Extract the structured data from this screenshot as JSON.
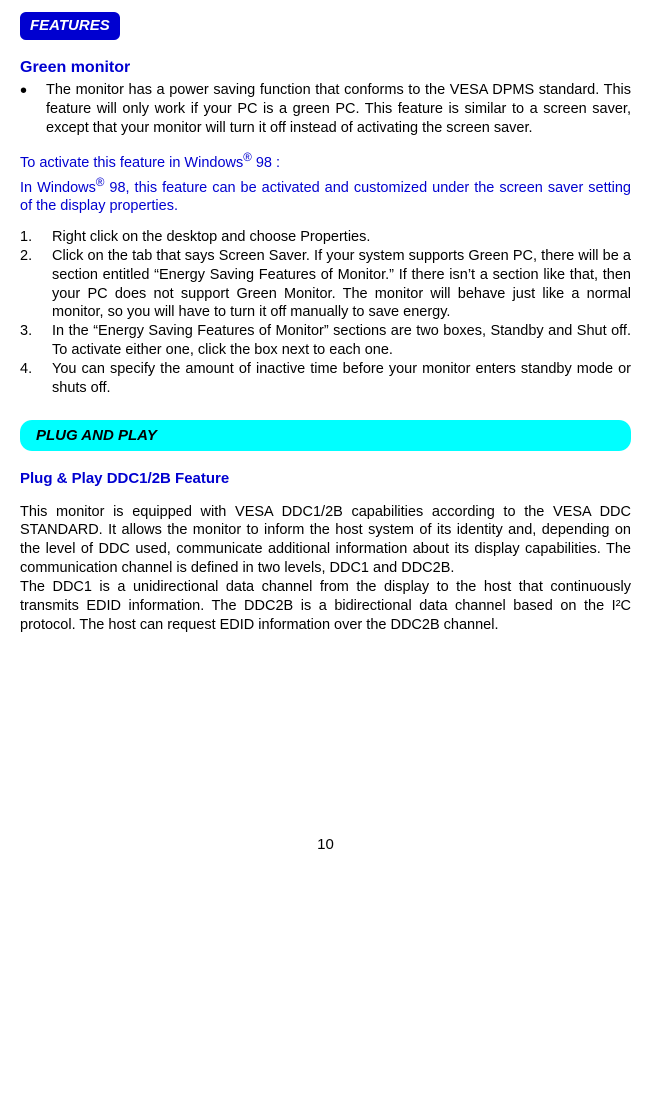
{
  "features_label": "FEATURES",
  "green_heading": "Green monitor",
  "green_bullet": "The monitor has a power saving function that conforms to the VESA DPMS standard. This feature will only work if your PC is a green PC. This feature is similar to a screen saver, except that your monitor will turn it off instead of activating the screen saver.",
  "activate_lead_pre": "To activate this feature in Windows",
  "activate_lead_post": " 98 :",
  "activate_body_pre": "In Windows",
  "activate_body_post": " 98, this feature can be activated and customized under the screen saver setting of the display properties.",
  "steps": [
    "Right click on the desktop and choose Properties.",
    "Click on the tab that says Screen Saver. If your system supports Green PC, there will be a section entitled “Energy Saving Features of Monitor.” If there isn’t a section like that, then your PC does not support Green Monitor. The monitor will behave just like a normal monitor, so you will have to turn it off manually to save energy.",
    "In the “Energy Saving Features of Monitor” sections are two boxes, Standby and Shut off. To activate either one, click the box next to each one.",
    "You can specify the amount of inactive time before your monitor enters standby mode or shuts off."
  ],
  "plug_label": "PLUG AND PLAY",
  "ddc_heading": "Plug & Play DDC1/2B Feature",
  "ddc_para1": "This monitor is equipped with VESA DDC1/2B capabilities according to the VESA DDC STANDARD. It allows the monitor to inform the host system of its identity and, depending on the level of DDC used, communicate additional information about its display capabilities. The communication channel is defined in two levels, DDC1 and DDC2B.",
  "ddc_para2": "The DDC1 is a unidirectional data channel from the display to the host that continuously transmits EDID information. The DDC2B is a bidirectional data channel based on the I²C protocol. The host can request EDID information over the DDC2B channel.",
  "page_number": "10",
  "register_mark": "®"
}
